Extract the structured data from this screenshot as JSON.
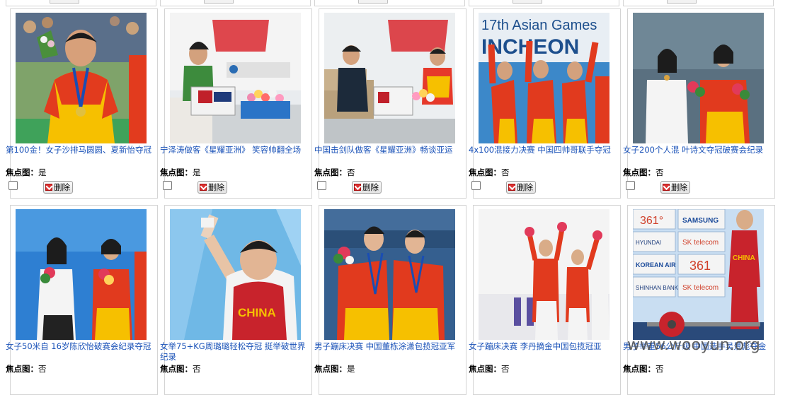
{
  "focus_label": "焦点图：",
  "delete_label": "删除",
  "watermark": "www.wooyun.org",
  "row1": [
    {
      "caption": "第100金！女子沙排马圆圆、夏新怡夺冠",
      "focus": "是",
      "scene": "beach-volleyball-medalist"
    },
    {
      "caption": "宁泽涛做客《星耀亚洲》 笑容帅翻全场",
      "focus": "是",
      "scene": "tv-studio-interview"
    },
    {
      "caption": "中国击剑队做客《星耀亚洲》畅谈亚运",
      "focus": "否",
      "scene": "tv-studio-interview"
    },
    {
      "caption": "4x100混接力决赛 中国四帅哥联手夺冠",
      "focus": "否",
      "scene": "relay-swimmers-podium",
      "photo_text": "17th Asian Games INCHEON"
    },
    {
      "caption": "女子200个人混 叶诗文夺冠破赛会纪录",
      "focus": "否",
      "scene": "swimmers-podium"
    }
  ],
  "row2": [
    {
      "caption": "女子50米自 16岁陈欣怡破赛会纪录夺冠",
      "focus": "否",
      "scene": "swimmers-podium"
    },
    {
      "caption": "女举75+KG周璐璐轻松夺冠 挺举破世界纪录",
      "focus": "否",
      "scene": "weightlifter",
      "photo_text": "CHINA"
    },
    {
      "caption": "男子蹦床决赛 中国董栋涂潇包揽冠亚军",
      "focus": "是",
      "scene": "trampoline-medalists"
    },
    {
      "caption": "女子蹦床决赛 李丹摘金中国包揽冠亚",
      "focus": "否",
      "scene": "trampoline-podium"
    },
    {
      "caption": "男子举重56公斤级 中国选手吴景彪夺金",
      "focus": "否",
      "scene": "weightlifter-lift",
      "photo_text": [
        "361°",
        "SAMSUNG",
        "HYUNDAI",
        "SK telecom",
        "KOREAN AIR",
        "361",
        "SHINHAN BANK",
        "CHINA"
      ]
    }
  ]
}
